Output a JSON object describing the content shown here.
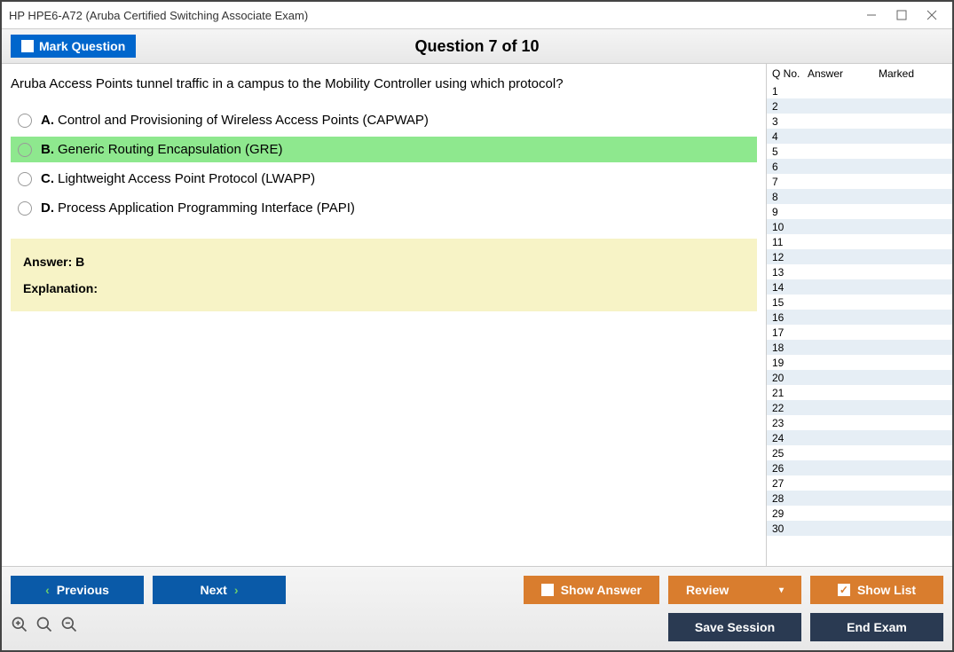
{
  "window": {
    "title": "HP HPE6-A72 (Aruba Certified Switching Associate Exam)"
  },
  "header": {
    "mark_label": "Mark Question",
    "counter": "Question 7 of 10"
  },
  "question": {
    "text": "Aruba Access Points tunnel traffic in a campus to the Mobility Controller using which protocol?",
    "options": [
      {
        "letter": "A.",
        "text": "Control and Provisioning of Wireless Access Points (CAPWAP)",
        "correct": false
      },
      {
        "letter": "B.",
        "text": "Generic Routing Encapsulation (GRE)",
        "correct": true
      },
      {
        "letter": "C.",
        "text": "Lightweight Access Point Protocol (LWAPP)",
        "correct": false
      },
      {
        "letter": "D.",
        "text": "Process Application Programming Interface (PAPI)",
        "correct": false
      }
    ],
    "answer_label": "Answer: B",
    "explanation_label": "Explanation:"
  },
  "side": {
    "header": {
      "qno": "Q No.",
      "answer": "Answer",
      "marked": "Marked"
    },
    "row_count": 30
  },
  "footer": {
    "previous": "Previous",
    "next": "Next",
    "show_answer": "Show Answer",
    "review": "Review",
    "show_list": "Show List",
    "save_session": "Save Session",
    "end_exam": "End Exam"
  }
}
